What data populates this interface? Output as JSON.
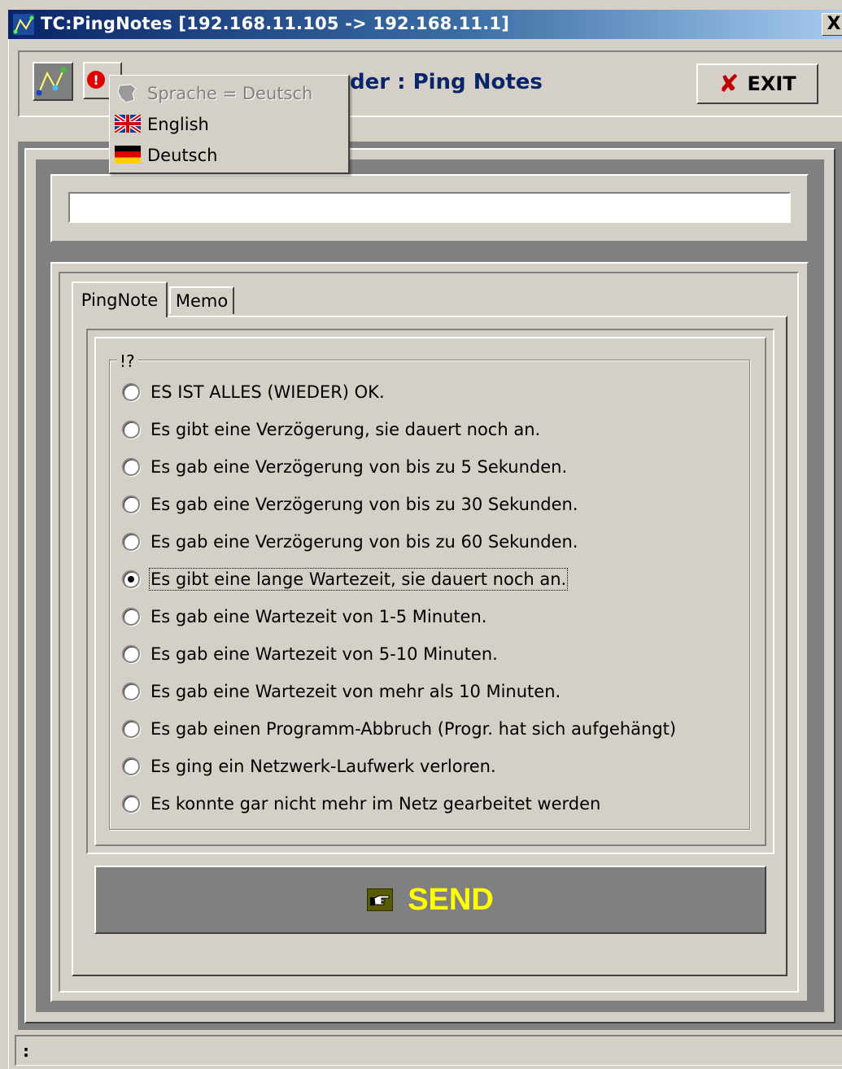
{
  "window": {
    "title": "TC:PingNotes [192.168.11.105 -> 192.168.11.1]",
    "close_glyph": "X"
  },
  "header": {
    "title_visible": "der : Ping Notes",
    "exit_label": "EXIT",
    "exit_icon": "red-x-icon"
  },
  "language_menu": {
    "current": "Sprache = Deutsch",
    "items": [
      {
        "label": "English",
        "icon": "uk-flag-icon"
      },
      {
        "label": "Deutsch",
        "icon": "german-flag-icon"
      }
    ]
  },
  "note_input": {
    "value": "",
    "placeholder": ""
  },
  "tabs": [
    {
      "label": "PingNote",
      "active": true
    },
    {
      "label": "Memo",
      "active": false
    }
  ],
  "group": {
    "caption": "!?",
    "options": [
      {
        "label": "ES IST ALLES (WIEDER) OK.",
        "checked": false
      },
      {
        "label": "Es gibt eine Verzögerung, sie dauert noch an.",
        "checked": false
      },
      {
        "label": "Es gab eine Verzögerung von bis zu 5 Sekunden.",
        "checked": false
      },
      {
        "label": "Es gab eine Verzögerung von bis zu 30 Sekunden.",
        "checked": false
      },
      {
        "label": "Es gab eine Verzögerung von bis zu 60 Sekunden.",
        "checked": false
      },
      {
        "label": "Es gibt eine lange Wartezeit, sie dauert noch an.",
        "checked": true
      },
      {
        "label": "Es gab eine Wartezeit von 1-5 Minuten.",
        "checked": false
      },
      {
        "label": "Es gab eine Wartezeit von 5-10 Minuten.",
        "checked": false
      },
      {
        "label": "Es gab eine Wartezeit von mehr als 10 Minuten.",
        "checked": false
      },
      {
        "label": "Es gab einen Programm-Abbruch (Progr. hat sich aufgehängt)",
        "checked": false
      },
      {
        "label": "Es ging ein Netzwerk-Laufwerk verloren.",
        "checked": false
      },
      {
        "label": "Es konnte gar nicht mehr im Netz gearbeitet werden",
        "checked": false
      }
    ]
  },
  "send": {
    "label": "SEND",
    "icon": "pointing-hand-icon"
  },
  "statusbar": {
    "text": ":"
  },
  "colors": {
    "title_gradient_start": "#0a246a",
    "title_gradient_end": "#a6caf0",
    "header_title": "#0a246a",
    "exit_x": "#c00000",
    "send_text": "#ffff00",
    "send_bg": "#808080",
    "face": "#d4d0c8"
  }
}
